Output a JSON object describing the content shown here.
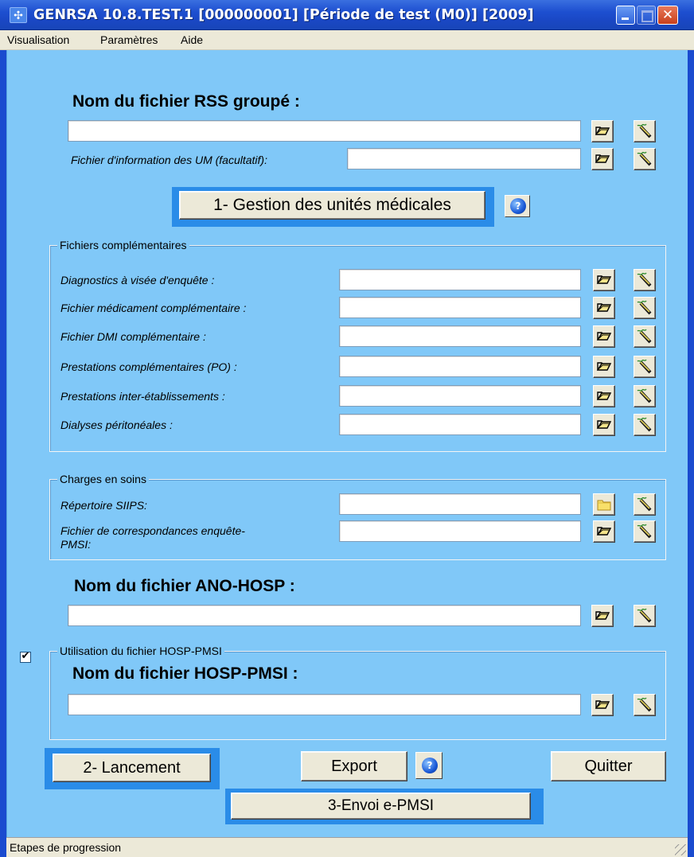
{
  "window": {
    "title": "GENRSA 10.8.TEST.1  [000000001]  [Période de test (M0)]  [2009]",
    "close_glyph": "✕"
  },
  "menu": {
    "items": [
      {
        "label": "Visualisation"
      },
      {
        "label": "Paramètres"
      },
      {
        "label": "Aide"
      }
    ]
  },
  "rss": {
    "title": "Nom du fichier RSS groupé :",
    "value": "",
    "um_label": "Fichier d'information des UM (facultatif):",
    "um_value": ""
  },
  "buttons": {
    "gestion": "1- Gestion des unités médicales",
    "help": "?",
    "lancement": "2- Lancement",
    "export": "Export",
    "quitter": "Quitter",
    "envoi": "3-Envoi e-PMSI"
  },
  "complementaires": {
    "title": "Fichiers complémentaires",
    "rows": [
      {
        "label": "Diagnostics à visée d'enquête :",
        "value": ""
      },
      {
        "label": "Fichier médicament complémentaire :",
        "value": ""
      },
      {
        "label": "Fichier DMI complémentaire :",
        "value": ""
      },
      {
        "label": "Prestations complémentaires (PO) :",
        "value": ""
      },
      {
        "label": "Prestations inter-établissements :",
        "value": ""
      },
      {
        "label": "Dialyses péritonéales :",
        "value": ""
      }
    ]
  },
  "charges": {
    "title": "Charges en soins",
    "repertoire_label": "Répertoire SIIPS:",
    "repertoire_value": "",
    "correspondance_label_line1": "Fichier de correspondances enquête-",
    "correspondance_label_line2": "PMSI:",
    "correspondance_value": ""
  },
  "ano_hosp": {
    "title": "Nom du fichier ANO-HOSP :",
    "value": ""
  },
  "hosp_pmsi": {
    "checkbox_checked": true,
    "check_glyph": "✔",
    "group_title": "Utilisation du fichier HOSP-PMSI",
    "title": "Nom du fichier HOSP-PMSI :",
    "value": ""
  },
  "status": {
    "text": "Etapes de progression"
  },
  "colors": {
    "client_bg": "#80c8f8",
    "highlight": "#2a8ce8",
    "titlebar": "#1d4fd0"
  },
  "icons": {
    "open": "open-file-icon",
    "edit": "edit-pen-icon",
    "folder": "folder-icon",
    "help": "help-icon"
  }
}
